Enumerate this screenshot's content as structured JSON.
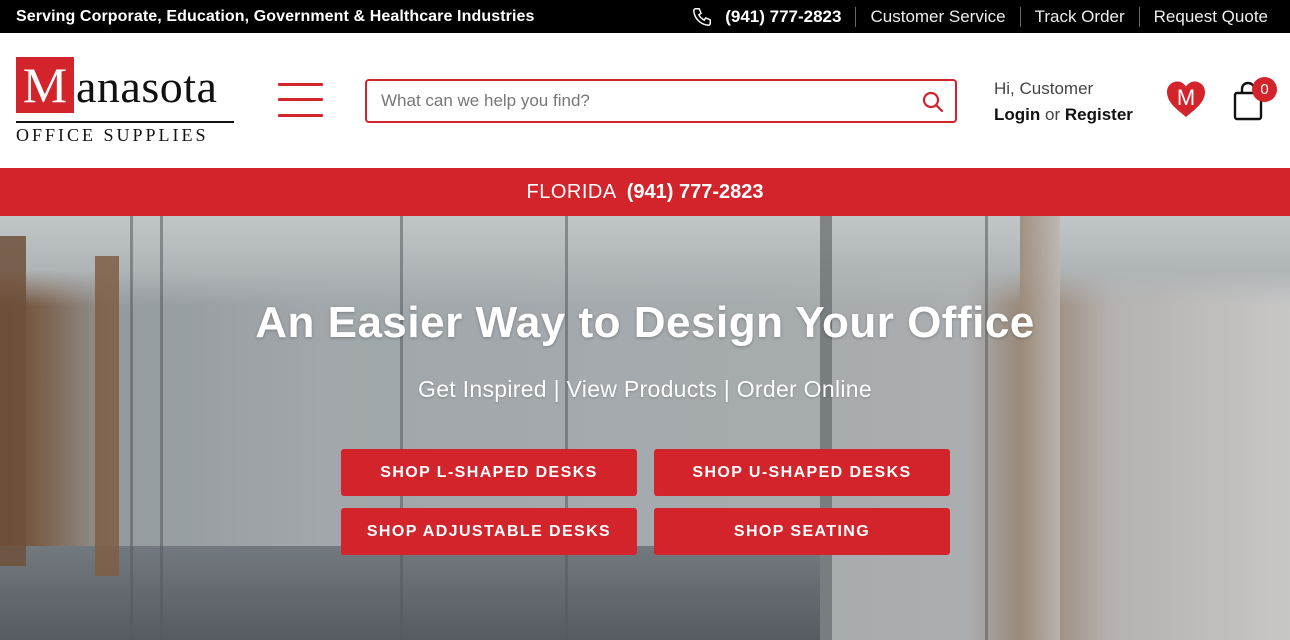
{
  "topbar": {
    "tagline": "Serving Corporate, Education, Government & Healthcare Industries",
    "phone": "(941) 777-2823",
    "links": [
      "Customer Service",
      "Track Order",
      "Request Quote"
    ]
  },
  "header": {
    "logo": {
      "initial": "M",
      "rest": "anasota",
      "subtitle": "OFFICE SUPPLIES"
    },
    "search": {
      "placeholder": "What can we help you find?",
      "value": ""
    },
    "account": {
      "greeting": "Hi, Customer",
      "login": "Login",
      "or": "or",
      "register": "Register"
    },
    "wishlist_letter": "M",
    "cart_count": "0"
  },
  "banner": {
    "state": "FLORIDA",
    "phone": "(941) 777-2823"
  },
  "hero": {
    "title": "An Easier Way to Design Your Office",
    "subtitle": "Get Inspired | View Products | Order Online",
    "buttons": {
      "l_shaped": "SHOP L-SHAPED DESKS",
      "u_shaped": "SHOP U-SHAPED DESKS",
      "adjustable": "SHOP ADJUSTABLE DESKS",
      "seating": "SHOP SEATING"
    }
  },
  "colors": {
    "brand_red": "#d3242c",
    "topbar_bg": "#000000"
  },
  "icons": [
    "phone-icon",
    "hamburger-icon",
    "search-icon",
    "heart-icon",
    "shopping-bag-icon"
  ]
}
